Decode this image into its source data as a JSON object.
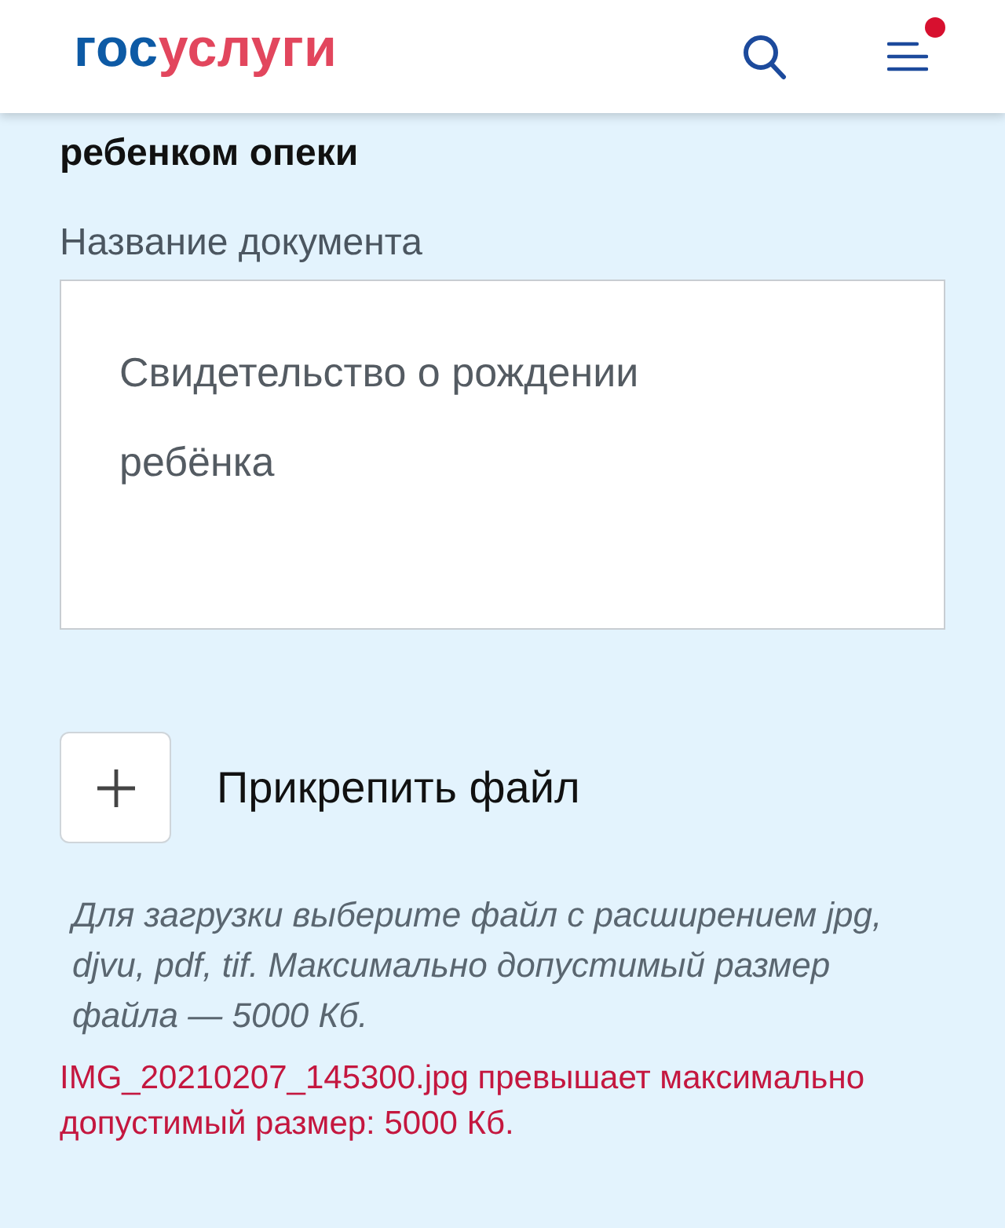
{
  "header": {
    "logo": {
      "part_1": "гос",
      "part_2": "услуги"
    },
    "menu": {
      "has_notification": true
    }
  },
  "section": {
    "title": "ребенком опеки"
  },
  "document_name": {
    "label": "Название документа",
    "value": "Свидетельство о рождении ребёнка"
  },
  "attach": {
    "label": "Прикрепить файл"
  },
  "hint": "Для загрузки выберите файл с расширением jpg, djvu, pdf, tif. Максимально допустимый размер файла — 5000 Кб.",
  "error": "IMG_20210207_145300.jpg превышает максимально допустимый размер: 5000 Кб."
}
